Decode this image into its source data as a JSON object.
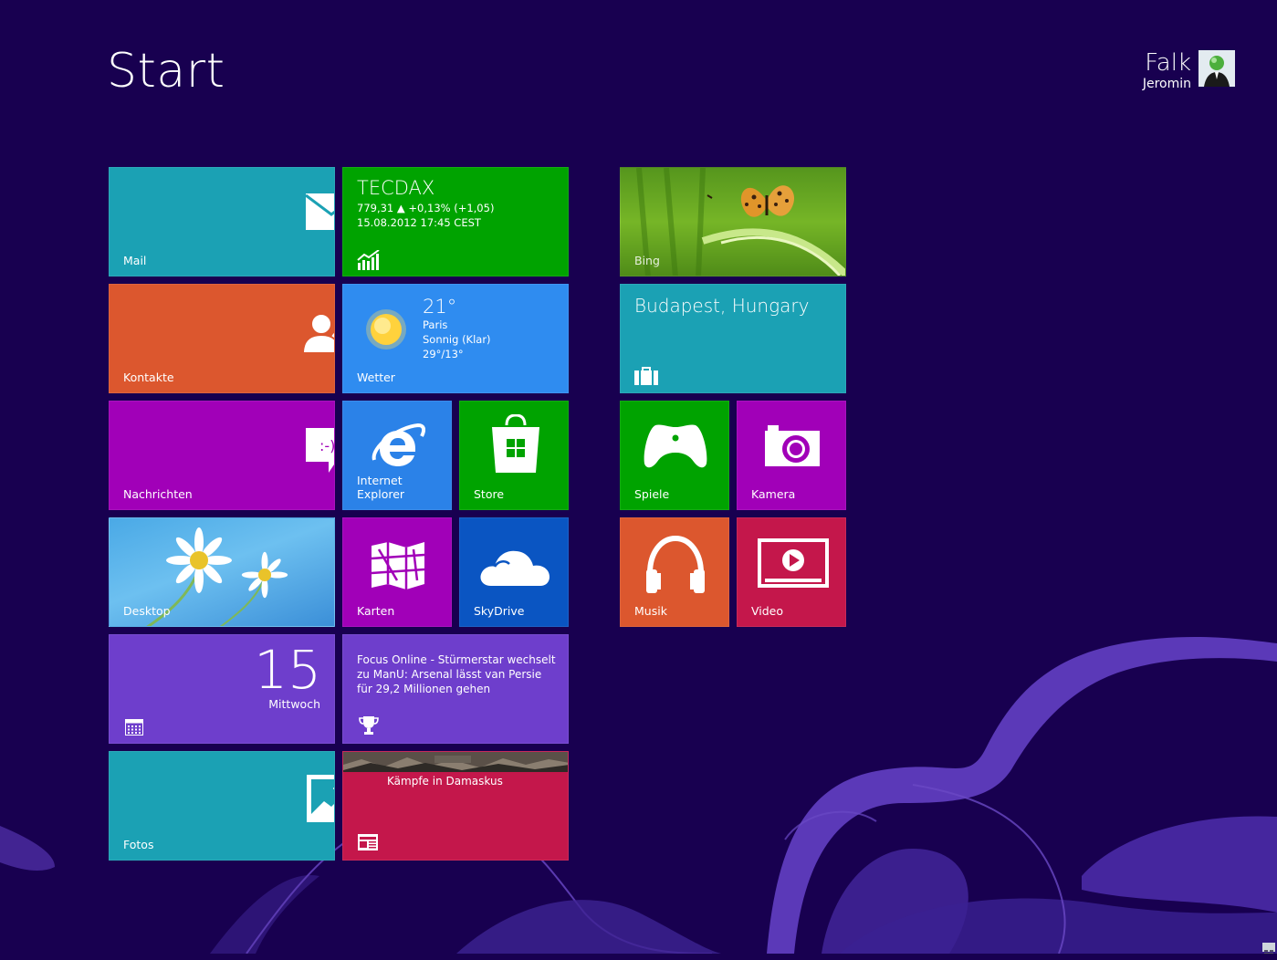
{
  "header": {
    "title": "Start"
  },
  "user": {
    "first_name": "Falk",
    "last_name": "Jeromin"
  },
  "tiles": {
    "mail": {
      "label": "Mail",
      "color": "#1ba1b4"
    },
    "tecdax": {
      "name": "TECDAX",
      "line1": "779,31 ▲ +0,13% (+1,05)",
      "line2": "15.08.2012 17:45 CEST",
      "color": "#00a300"
    },
    "bing": {
      "label": "Bing"
    },
    "contacts": {
      "label": "Kontakte",
      "color": "#dc572e"
    },
    "weather": {
      "temp": "21°",
      "city": "Paris",
      "cond": "Sonnig (Klar)",
      "range": "29°/13°",
      "label": "Wetter",
      "color": "#2f8cf0"
    },
    "travel": {
      "place": "Budapest, Hungary",
      "color": "#1ba1b4"
    },
    "messages": {
      "label": "Nachrichten",
      "color": "#a100b8"
    },
    "ie": {
      "label": "Internet Explorer",
      "color": "#2b82e8"
    },
    "store": {
      "label": "Store",
      "color": "#00a300"
    },
    "games": {
      "label": "Spiele",
      "color": "#00a300"
    },
    "camera": {
      "label": "Kamera",
      "color": "#a100b8"
    },
    "desktop": {
      "label": "Desktop"
    },
    "maps": {
      "label": "Karten",
      "color": "#a100b8"
    },
    "skydrive": {
      "label": "SkyDrive",
      "color": "#0a55c2"
    },
    "music": {
      "label": "Musik",
      "color": "#dc572e"
    },
    "video": {
      "label": "Video",
      "color": "#c4174b"
    },
    "calendar": {
      "day": "15",
      "weekday": "Mittwoch",
      "color": "#6e3ecc"
    },
    "sports": {
      "headline": "Focus Online - Stürmerstar wechselt zu ManU: Arsenal lässt van Persie für 29,2 Millionen gehen",
      "color": "#6e3ecc"
    },
    "photos": {
      "label": "Fotos",
      "color": "#1ba1b4"
    },
    "news": {
      "headline": "Kämpfe in Damaskus",
      "color": "#c4174b"
    }
  }
}
